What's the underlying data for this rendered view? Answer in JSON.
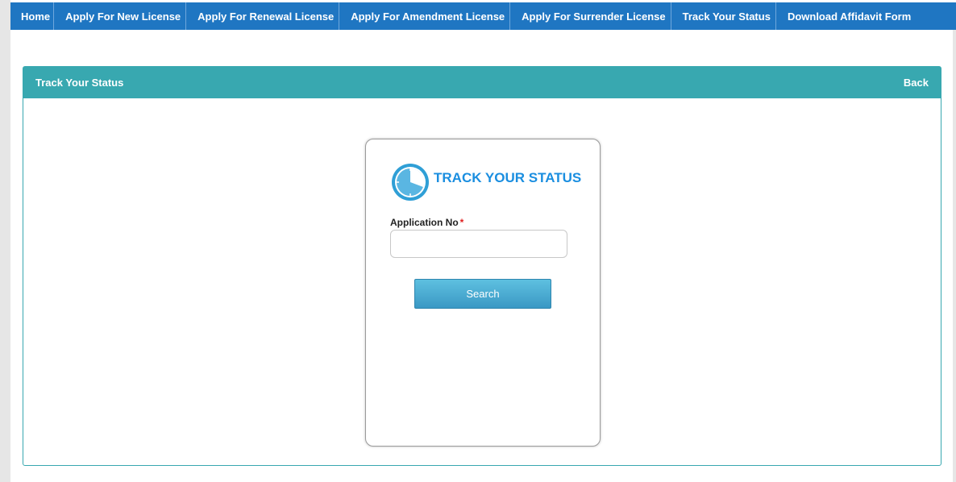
{
  "nav": {
    "items": [
      {
        "label": "Home"
      },
      {
        "label": "Apply For New License"
      },
      {
        "label": "Apply For Renewal License"
      },
      {
        "label": "Apply For Amendment License"
      },
      {
        "label": "Apply For Surrender License"
      },
      {
        "label": "Track Your Status"
      },
      {
        "label": "Download Affidavit Form"
      }
    ]
  },
  "panel": {
    "title": "Track Your Status",
    "back_label": "Back"
  },
  "card": {
    "title": "TRACK YOUR STATUS",
    "icon": "clock-icon",
    "field_label": "Application No",
    "required_marker": "*",
    "input_value": "",
    "input_placeholder": "",
    "search_label": "Search"
  },
  "colors": {
    "nav_bg": "#1f76c2",
    "panel_header": "#38a8b0",
    "title_blue": "#1a8ee0",
    "required": "#e02020"
  }
}
